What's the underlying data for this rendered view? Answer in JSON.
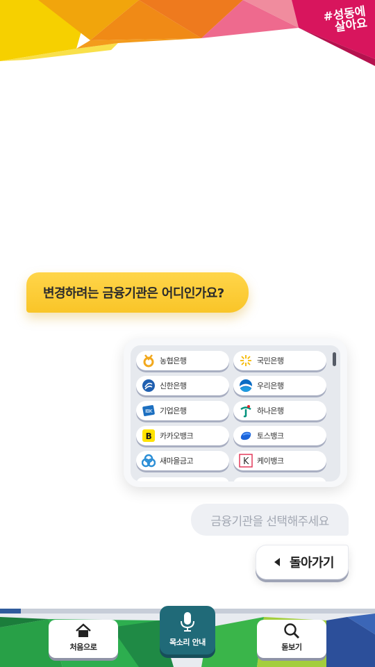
{
  "brand": {
    "line1": "#성동에",
    "line2": "살아요"
  },
  "question": "변경하려는 금융기관은 어디인가요?",
  "banks": [
    {
      "name": "농협은행",
      "icon": "nonghyup-logo-icon"
    },
    {
      "name": "국민은행",
      "icon": "kb-logo-icon"
    },
    {
      "name": "신한은행",
      "icon": "shinhan-logo-icon"
    },
    {
      "name": "우리은행",
      "icon": "woori-logo-icon"
    },
    {
      "name": "기업은행",
      "icon": "ibk-logo-icon"
    },
    {
      "name": "하나은행",
      "icon": "hana-logo-icon"
    },
    {
      "name": "카카오뱅크",
      "icon": "kakaobank-logo-icon",
      "glyph": "B"
    },
    {
      "name": "토스뱅크",
      "icon": "tossbank-logo-icon"
    },
    {
      "name": "새마을금고",
      "icon": "mg-logo-icon"
    },
    {
      "name": "케이뱅크",
      "icon": "kbank-logo-icon",
      "glyph": "K"
    }
  ],
  "hint": "금융기관을 선택해주세요",
  "back_label": "돌아가기",
  "progress": 0.055,
  "nav": {
    "home_label": "처음으로",
    "voice_label": "목소리 안내",
    "magnify_label": "돋보기"
  },
  "colors": {
    "accent_yellow": "#f9c528",
    "voice_teal": "#206a78",
    "progress_blue": "#2f5b9c"
  }
}
